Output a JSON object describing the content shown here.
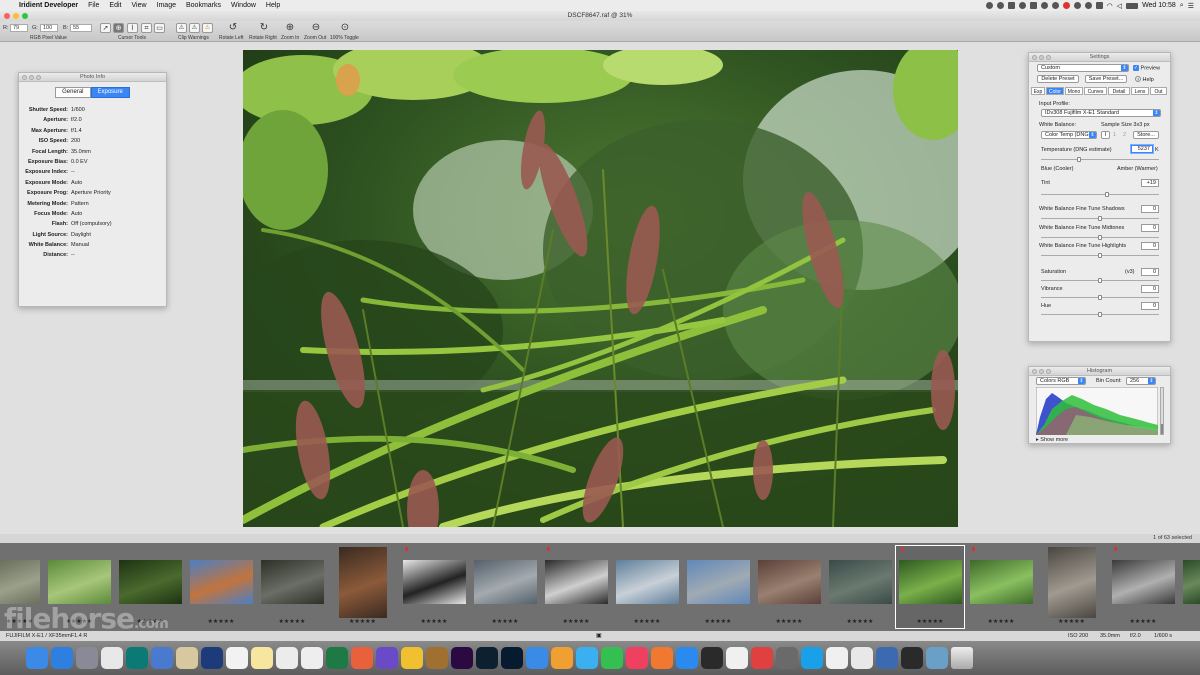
{
  "menubar": {
    "app_name": "Iridient Developer",
    "items": [
      "File",
      "Edit",
      "View",
      "Image",
      "Bookmarks",
      "Window",
      "Help"
    ],
    "clock": "Wed 10:58"
  },
  "window": {
    "title": "DSCF8647.raf @ 31%"
  },
  "toolbar": {
    "r_label": "R:",
    "r_value": "79",
    "g_label": "G:",
    "g_value": "100",
    "b_label": "B:",
    "b_value": "55",
    "rgb_caption": "RGB Pixel Value",
    "cursor_caption": "Cursor Tools",
    "clip_caption": "Clip Warnings",
    "rotate_left": "Rotate Left",
    "rotate_right": "Rotate Right",
    "zoom_in": "Zoom In",
    "zoom_out": "Zoom Out",
    "toggle_100": "100% Toggle"
  },
  "photo_info": {
    "title": "Photo Info",
    "tabs": [
      "General",
      "Exposure"
    ],
    "active_tab": "Exposure",
    "rows": [
      {
        "k": "Shutter Speed:",
        "v": "1/600"
      },
      {
        "k": "Aperture:",
        "v": "f/2.0"
      },
      {
        "k": "Max Aperture:",
        "v": "f/1.4"
      },
      {
        "k": "ISO Speed:",
        "v": "200"
      },
      {
        "k": "Focal Length:",
        "v": "35.0mm"
      },
      {
        "k": "Exposure Bias:",
        "v": "0.0 EV"
      },
      {
        "k": "Exposure Index:",
        "v": "--"
      },
      {
        "k": "Exposure Mode:",
        "v": "Auto"
      },
      {
        "k": "Exposure Prog:",
        "v": "Aperture Priority"
      },
      {
        "k": "Metering Mode:",
        "v": "Pattern"
      },
      {
        "k": "Focus Mode:",
        "v": "Auto"
      },
      {
        "k": "Flash:",
        "v": "Off (compulsory)"
      },
      {
        "k": "Light Source:",
        "v": "Daylight"
      },
      {
        "k": "White Balance:",
        "v": "Manual"
      },
      {
        "k": "Distance:",
        "v": "--"
      }
    ]
  },
  "settings": {
    "title": "Settings",
    "preset": "Custom",
    "preview_label": "Preview",
    "delete_preset": "Delete Preset",
    "save_preset": "Save Preset...",
    "help": "Help",
    "tabs": [
      "Exp",
      "Color",
      "Mono",
      "Curves",
      "Detail",
      "Lens",
      "Out"
    ],
    "active_tab": "Color",
    "input_profile_label": "Input Profile:",
    "input_profile": "IDv308 Fujifilm X-E1 Standard",
    "white_balance_label": "White Balance:",
    "sample_size": "Sample Size 3x3 px",
    "wb_mode": "Color Temp (DNG",
    "store": "Store...",
    "temperature_label": "Temperature (DNG estimate)",
    "temperature_value": "5237",
    "temperature_unit": "K",
    "blue_label": "Blue (Cooler)",
    "amber_label": "Amber (Warmer)",
    "tint_label": "Tint",
    "tint_value": "+19",
    "wb_shadows_label": "White Balance Fine Tune Shadows",
    "wb_shadows_value": "0",
    "wb_midtones_label": "White Balance Fine Tune Midtones",
    "wb_midtones_value": "0",
    "wb_highlights_label": "White Balance Fine Tune Highlights",
    "wb_highlights_value": "0",
    "saturation_label": "Saturation",
    "saturation_mode": "(v3)",
    "saturation_value": "0",
    "vibrance_label": "Vibrance",
    "vibrance_value": "0",
    "hue_label": "Hue",
    "hue_value": "0"
  },
  "histogram": {
    "title": "Histogram",
    "mode": "Colors RGB",
    "bin_label": "Bin Count:",
    "bin_count": "256",
    "show_more": "Show more"
  },
  "status": {
    "selection": "1 of 63 selected",
    "camera": "FUJIFILM X-E1 / XF35mmF1.4 R",
    "iso": "ISO 200",
    "focal": "35.0mm",
    "aperture": "f/2.0",
    "shutter": "1/600 s"
  },
  "filmstrip": {
    "rating": "★★★★★"
  },
  "watermark": {
    "text": "filehorse",
    "suffix": ".com"
  },
  "dock": {
    "apps": [
      "finder",
      "safari",
      "launchpad",
      "chrome",
      "sketchup",
      "preview",
      "cinema4d",
      "calendar",
      "notes",
      "reminders",
      "numbers",
      "excel",
      "office",
      "affinity",
      "textedit",
      "coffee",
      "premiere",
      "lightroom",
      "photoshop",
      "iridient",
      "photos",
      "messages",
      "facetime",
      "itunes",
      "ibooks",
      "appstore",
      "preview2",
      "calendar2",
      "chess",
      "skype",
      "scripts",
      "notes2",
      "mylio",
      "finder2",
      "bbedit",
      "network",
      "folder",
      "trash"
    ]
  }
}
